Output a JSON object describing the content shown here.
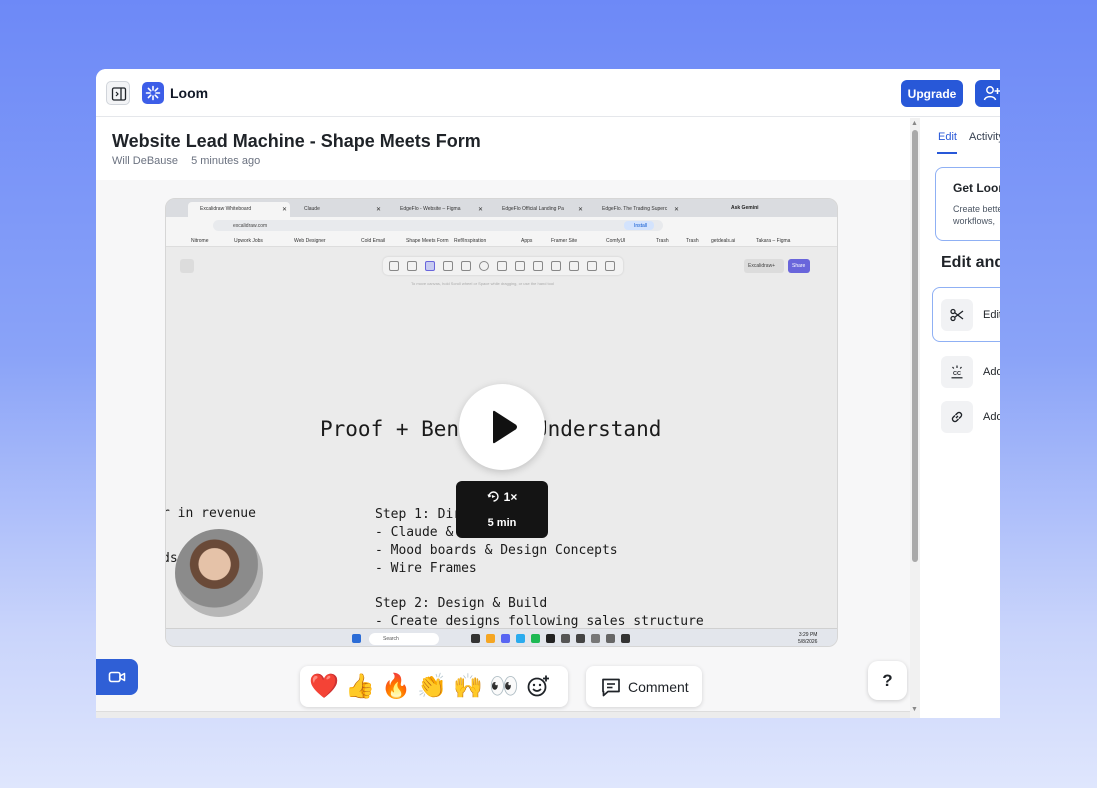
{
  "app": {
    "name": "Loom"
  },
  "header": {
    "upgrade_label": "Upgrade"
  },
  "video": {
    "title": "Website Lead Machine - Shape Meets Form",
    "author": "Will DeBause",
    "timestamp": "5 minutes ago",
    "speed": "1×",
    "duration": "5 min"
  },
  "screen": {
    "tabs": [
      "Excalidraw Whiteboard",
      "Claude",
      "EdgeFlo - Website – Figma",
      "EdgeFlo Official Landing Pa",
      "EdgeFlo. The Trading Superc"
    ],
    "ask_gemini": "Ask Gemini",
    "url": "excalidraw.com",
    "install": "Install",
    "bookmarks": [
      "Nitrome",
      "Upwork Jobs",
      "Web Designer",
      "Cold Email",
      "Shape Meets Form",
      "Ref/Inspiration",
      "Apps",
      "Framer Site",
      "ComfyUI",
      "Trash",
      "Trash",
      "getdeals.ai",
      "Takara – Figma"
    ],
    "lib_label": "Excalidraw+",
    "share_label": "Share",
    "hint": "To move canvas, hold Scroll wheel or Space while dragging, or use the hand tool",
    "heading": "Proof + Benefits Understand",
    "left_fragment_1": "r in revenue",
    "left_fragment_2": "ds",
    "steps": [
      "Step 1: Direction",
      "- Claude & ...",
      "- Mood boards & Design Concepts",
      "- Wire Frames",
      "",
      "Step 2: Design & Build",
      "- Create designs following sales structure"
    ],
    "taskbar_search": "Search",
    "clock_time": "3:29 PM",
    "clock_date": "5/8/2026"
  },
  "reactions": {
    "emojis": [
      "❤️",
      "👍",
      "🔥",
      "👏",
      "🙌",
      "👀"
    ]
  },
  "comment_label": "Comment",
  "help_label": "?",
  "sidebar": {
    "tabs": [
      "Edit",
      "Activity"
    ],
    "promo_title": "Get Loom",
    "promo_body_1": "Create better",
    "promo_body_2": "workflows,",
    "section_heading": "Edit and",
    "tools": [
      "Edit",
      "Add",
      "Add"
    ]
  },
  "colors": {
    "accent": "#2858d8",
    "logo": "#3d5ee8",
    "background_gradient_top": "#6d89f7",
    "background_gradient_bottom": "#dfe6fd"
  }
}
